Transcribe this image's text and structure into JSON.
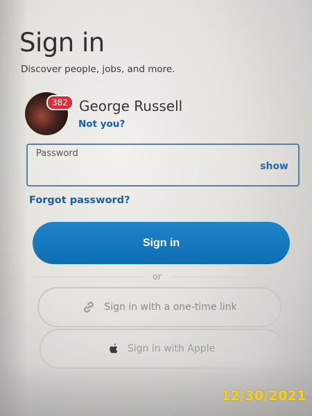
{
  "header": {
    "title": "Sign in",
    "subtitle": "Discover people, jobs, and more."
  },
  "user": {
    "name": "George Russell",
    "not_you": "Not you?",
    "notification_count": "382"
  },
  "password": {
    "label": "Password",
    "value": "",
    "show_label": "show"
  },
  "forgot_password": "Forgot password?",
  "signin_button": "Sign in",
  "divider": "or",
  "alt_signin": {
    "one_time_link": "Sign in with a one-time link",
    "apple": "Sign in with Apple"
  },
  "icons": {
    "link": "link-icon",
    "apple": "apple-icon"
  },
  "colors": {
    "primary": "#0d6db3",
    "link": "#1460b0",
    "badge": "#d7303a",
    "date_stamp": "#f6d21a"
  },
  "photo_date_stamp": "12/30/2021"
}
